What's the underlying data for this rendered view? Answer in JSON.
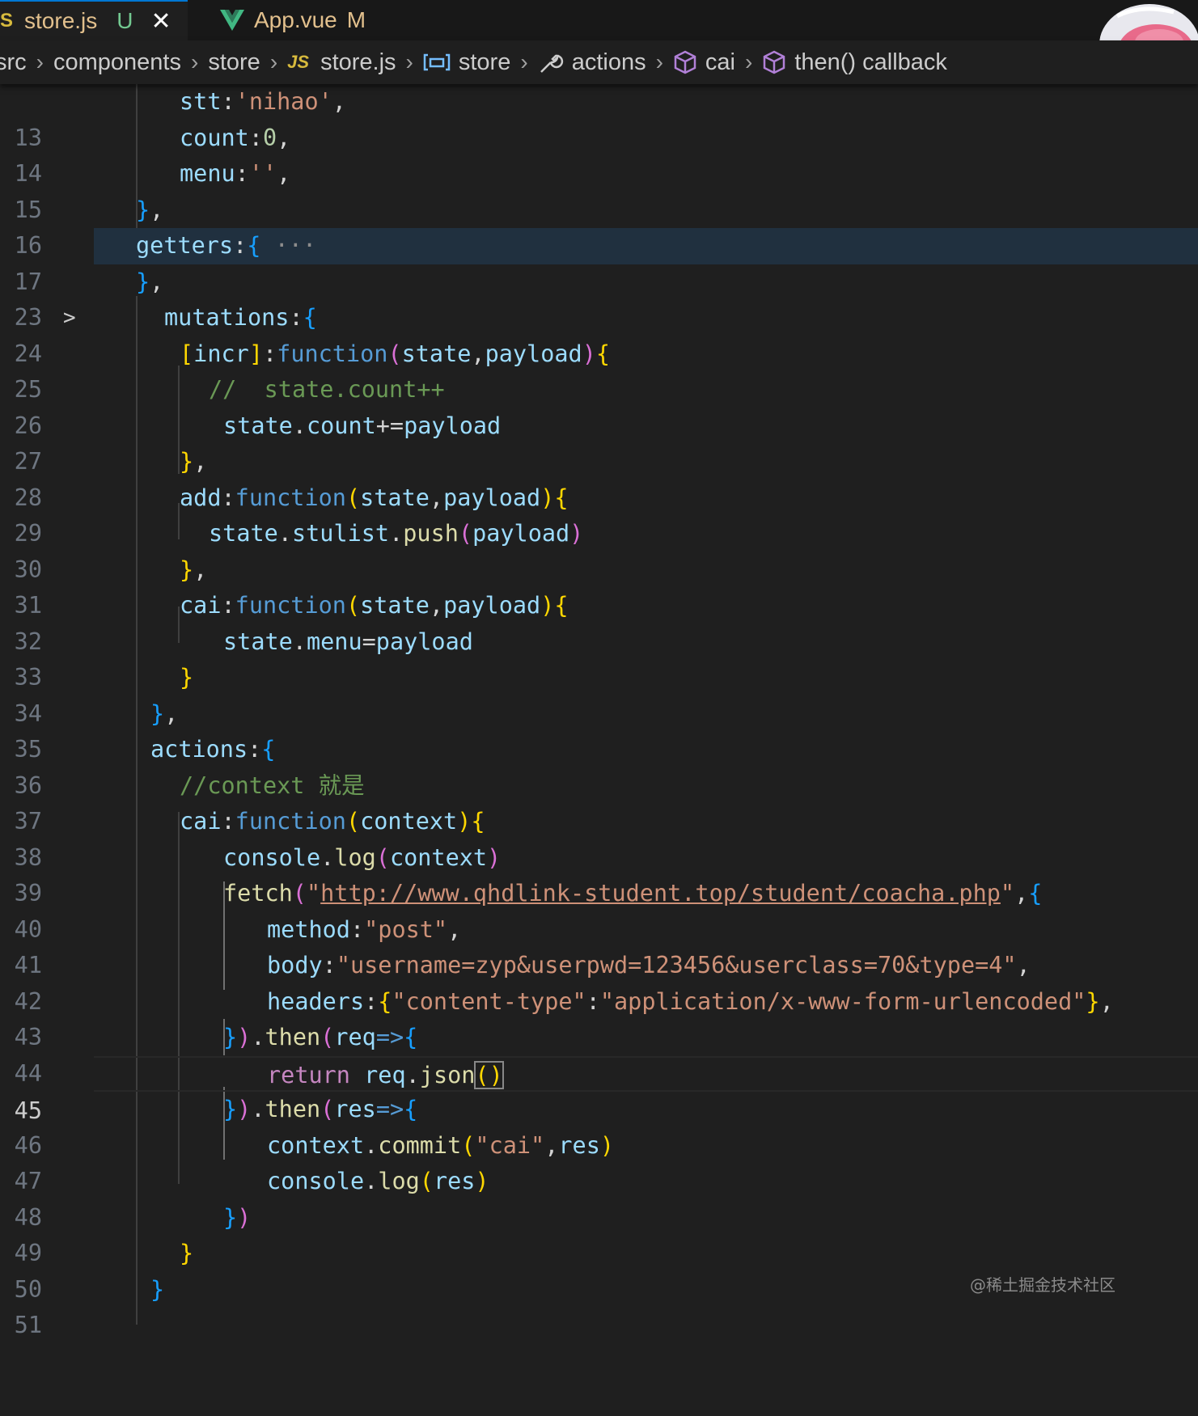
{
  "tabs": [
    {
      "icon_text": "S",
      "name": "store.js",
      "state": "U",
      "close": "✕"
    },
    {
      "name": "App.vue",
      "state": "M"
    }
  ],
  "breadcrumb": {
    "items": [
      "src",
      "components",
      "store",
      "store.js",
      "store",
      "actions",
      "cai",
      "then() callback"
    ],
    "js_label": "JS",
    "separator": "›"
  },
  "fold_ellipsis": "···",
  "lines": [
    {
      "n": "13",
      "code": "stt:'nihao',"
    },
    {
      "n": "14",
      "code": "count:0,"
    },
    {
      "n": "15",
      "code": "menu:'',"
    },
    {
      "n": "16",
      "code": "},"
    },
    {
      "n": "17",
      "code": "getters:{"
    },
    {
      "n": "23",
      "code": "},"
    },
    {
      "n": "24",
      "code": "mutations:{"
    },
    {
      "n": "25",
      "code": "[incr]:function(state,payload){"
    },
    {
      "n": "26",
      "code": "//  state.count++"
    },
    {
      "n": "27",
      "code": "state.count+=payload"
    },
    {
      "n": "28",
      "code": "},"
    },
    {
      "n": "29",
      "code": "add:function(state,payload){"
    },
    {
      "n": "30",
      "code": "state.stulist.push(payload)"
    },
    {
      "n": "31",
      "code": "},"
    },
    {
      "n": "32",
      "code": "cai:function(state,payload){"
    },
    {
      "n": "33",
      "code": "state.menu=payload"
    },
    {
      "n": "34",
      "code": "}"
    },
    {
      "n": "35",
      "code": "},"
    },
    {
      "n": "36",
      "code": "actions:{"
    },
    {
      "n": "37",
      "code": "//context 就是"
    },
    {
      "n": "38",
      "code": "cai:function(context){"
    },
    {
      "n": "39",
      "code": "console.log(context)"
    },
    {
      "n": "40",
      "code": "fetch(\"http://www.qhdlink-student.top/student/coacha.php\",{"
    },
    {
      "n": "41",
      "code": "method:\"post\","
    },
    {
      "n": "42",
      "code": "body:\"username=zyp&userpwd=123456&userclass=70&type=4\","
    },
    {
      "n": "43",
      "code": "headers:{\"content-type\":\"application/x-www-form-urlencoded\"},"
    },
    {
      "n": "44",
      "code": "}).then(req=>{"
    },
    {
      "n": "45",
      "code": "return req.json()"
    },
    {
      "n": "46",
      "code": "}).then(res=>{"
    },
    {
      "n": "47",
      "code": "context.commit(\"cai\",res)"
    },
    {
      "n": "48",
      "code": "console.log(res)"
    },
    {
      "n": "49",
      "code": "})"
    },
    {
      "n": "50",
      "code": "}"
    },
    {
      "n": "51",
      "code": "}"
    }
  ],
  "watermark": "@稀土掘金技术社区",
  "colors": {
    "background": "#1f1f1f",
    "keyword": "#569cd6",
    "property": "#9cdcfe",
    "string": "#ce9178",
    "comment": "#6a9955",
    "function": "#dcdcaa",
    "control": "#c586c0"
  }
}
